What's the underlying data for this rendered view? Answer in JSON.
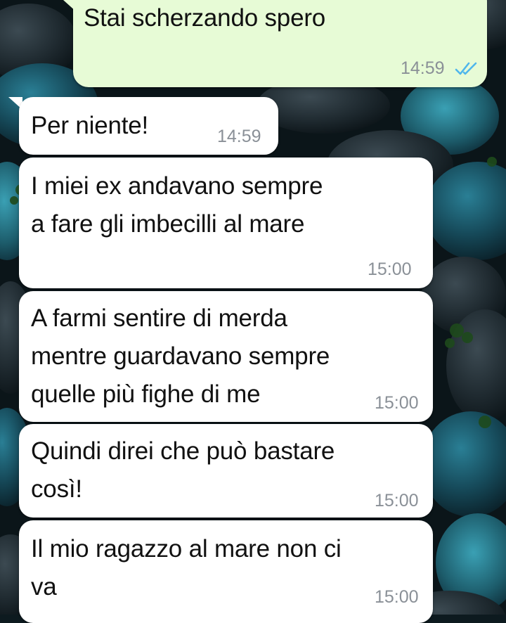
{
  "chat": {
    "messages": [
      {
        "direction": "outgoing",
        "text": "Stai scherzando spero",
        "time": "14:59",
        "status_icon": "double-check-read-icon"
      },
      {
        "direction": "incoming",
        "text": "Per niente!",
        "time": "14:59"
      },
      {
        "direction": "incoming",
        "text": "I miei ex andavano sempre\na fare gli imbecilli al mare",
        "time": "15:00"
      },
      {
        "direction": "incoming",
        "text": "A farmi sentire di merda\nmentre guardavano sempre\nquelle più fighe di me",
        "time": "15:00"
      },
      {
        "direction": "incoming",
        "text": "Quindi direi che può bastare\ncosì!",
        "time": "15:00"
      },
      {
        "direction": "incoming",
        "text": "Il mio ragazzo al mare non ci\nva",
        "time": "15:00"
      }
    ]
  },
  "colors": {
    "outgoing_bubble": "#e7fbd6",
    "incoming_bubble": "#ffffff",
    "read_ticks": "#4fb6ec",
    "timestamp": "#8a9097"
  }
}
